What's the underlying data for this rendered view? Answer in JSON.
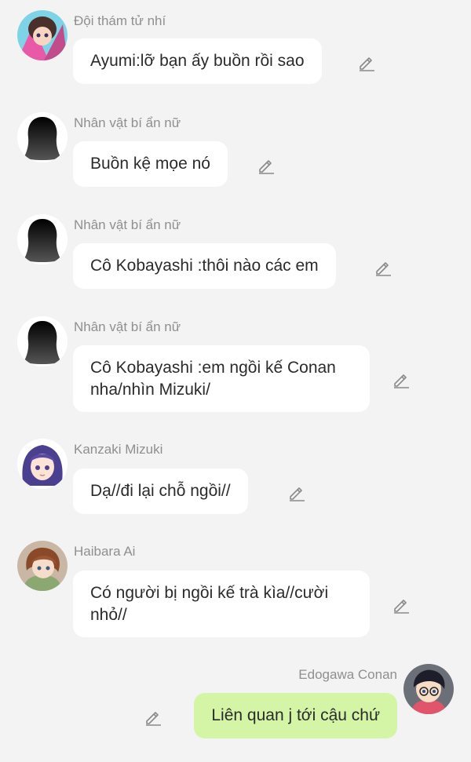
{
  "messages": [
    {
      "sender": "Đội thám tử nhí",
      "text": "Ayumi:lỡ bạn ấy buồn rồi sao",
      "avatar": "ayumi-avatar",
      "mine": false
    },
    {
      "sender": "Nhân vật bí ẩn nữ",
      "text": "Buồn kệ mọe nó",
      "avatar": "silhouette-avatar",
      "mine": false
    },
    {
      "sender": "Nhân vật bí ẩn nữ",
      "text": "Cô Kobayashi :thôi nào các em",
      "avatar": "silhouette-avatar",
      "mine": false
    },
    {
      "sender": "Nhân vật bí ẩn nữ",
      "text_line1": "Cô Kobayashi :em ngồi kế Conan",
      "text_line2": "nha/nhìn Mizuki/",
      "avatar": "silhouette-avatar",
      "mine": false
    },
    {
      "sender": "Kanzaki Mizuki",
      "text": "Dạ//đi lại chỗ ngồi//",
      "avatar": "mizuki-avatar",
      "mine": false
    },
    {
      "sender": "Haibara Ai",
      "text_line1": "Có người bị ngồi kế trà kìa//cười",
      "text_line2": "nhỏ//",
      "avatar": "haibara-avatar",
      "mine": false
    },
    {
      "sender": "Edogawa Conan",
      "text": "Liên quan j tới cậu chứ",
      "avatar": "conan-avatar",
      "mine": true
    }
  ],
  "icons": {
    "edit": "pencil-edit-icon"
  },
  "colors": {
    "background": "#f3f3f3",
    "bubble": "#ffffff",
    "my_bubble": "#d3f5a5",
    "sender": "#8f8f8f"
  }
}
